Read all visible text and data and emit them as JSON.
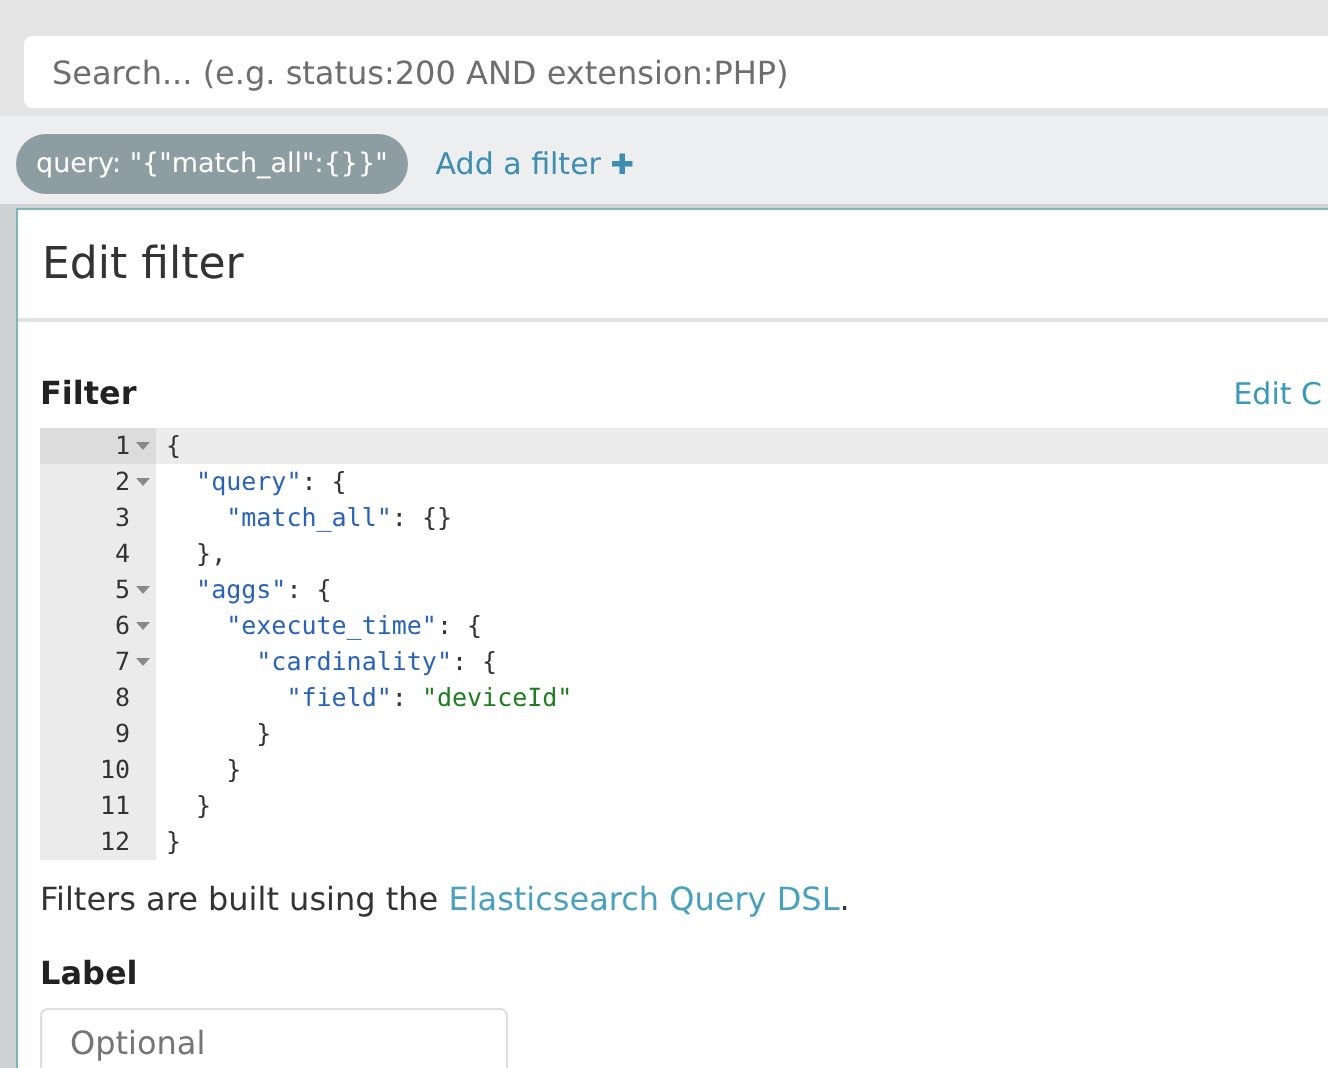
{
  "search": {
    "placeholder": "Search... (e.g. status:200 AND extension:PHP)"
  },
  "filter_bar": {
    "pills": [
      {
        "label": "query: \"{\"match_all\":{}}\""
      }
    ],
    "add_filter": {
      "label": "Add a filter",
      "icon": "✚"
    }
  },
  "modal": {
    "title": "Edit filter",
    "filter_label": "Filter",
    "edit_link": "Edit C",
    "code": [
      {
        "number": "1",
        "foldable": true,
        "active": true,
        "tokens": [
          {
            "kind": "punct",
            "text": "{"
          }
        ]
      },
      {
        "number": "2",
        "foldable": true,
        "active": false,
        "tokens": [
          {
            "kind": "key",
            "text": "  \"query\""
          },
          {
            "kind": "punct",
            "text": ": {"
          }
        ]
      },
      {
        "number": "3",
        "foldable": false,
        "active": false,
        "tokens": [
          {
            "kind": "key",
            "text": "    \"match_all\""
          },
          {
            "kind": "punct",
            "text": ": {}"
          }
        ]
      },
      {
        "number": "4",
        "foldable": false,
        "active": false,
        "tokens": [
          {
            "kind": "punct",
            "text": "  },"
          }
        ]
      },
      {
        "number": "5",
        "foldable": true,
        "active": false,
        "tokens": [
          {
            "kind": "key",
            "text": "  \"aggs\""
          },
          {
            "kind": "punct",
            "text": ": {"
          }
        ]
      },
      {
        "number": "6",
        "foldable": true,
        "active": false,
        "tokens": [
          {
            "kind": "key",
            "text": "    \"execute_time\""
          },
          {
            "kind": "punct",
            "text": ": {"
          }
        ]
      },
      {
        "number": "7",
        "foldable": true,
        "active": false,
        "tokens": [
          {
            "kind": "key",
            "text": "      \"cardinality\""
          },
          {
            "kind": "punct",
            "text": ": {"
          }
        ]
      },
      {
        "number": "8",
        "foldable": false,
        "active": false,
        "tokens": [
          {
            "kind": "key",
            "text": "        \"field\""
          },
          {
            "kind": "punct",
            "text": ": "
          },
          {
            "kind": "string",
            "text": "\"deviceId\""
          }
        ]
      },
      {
        "number": "9",
        "foldable": false,
        "active": false,
        "tokens": [
          {
            "kind": "punct",
            "text": "      }"
          }
        ]
      },
      {
        "number": "10",
        "foldable": false,
        "active": false,
        "tokens": [
          {
            "kind": "punct",
            "text": "    }"
          }
        ]
      },
      {
        "number": "11",
        "foldable": false,
        "active": false,
        "tokens": [
          {
            "kind": "punct",
            "text": "  }"
          }
        ]
      },
      {
        "number": "12",
        "foldable": false,
        "active": false,
        "tokens": [
          {
            "kind": "punct",
            "text": "}"
          }
        ]
      }
    ],
    "help_text": "Filters are built using the ",
    "help_link": "Elasticsearch Query DSL",
    "help_end": ".",
    "label_heading": "Label",
    "label_field": {
      "placeholder": "Optional"
    }
  }
}
